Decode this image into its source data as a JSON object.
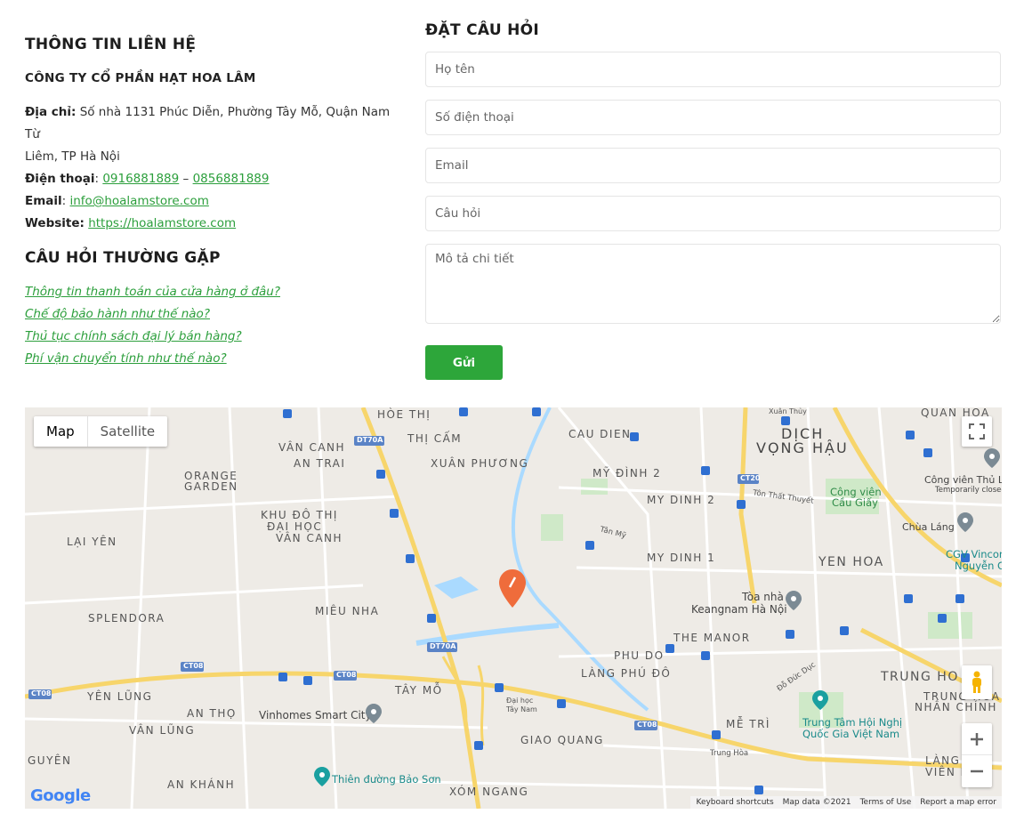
{
  "contact": {
    "title": "THÔNG TIN LIÊN HỆ",
    "company": "CÔNG TY CỔ PHẦN HẠT HOA LÂM",
    "address_label": "Địa chỉ:",
    "address_line1": "Số nhà 1131 Phúc Diễn, Phường Tây Mỗ, Quận Nam Từ",
    "address_line2": "Liêm, TP Hà Nội",
    "phone_label": "Điện thoại",
    "phone1": "0916881889",
    "phone_sep": " – ",
    "phone2": "0856881889",
    "email_label": "Email",
    "email": "info@hoalamstore.com",
    "website_label": "Website:",
    "website": "https://hoalamstore.com"
  },
  "faq": {
    "title": "CÂU HỎI THƯỜNG GẶP",
    "items": [
      "Thông tin thanh toán của cửa hàng ở đâu?",
      "Chế độ bảo hành như thế nào?",
      "Thủ tục chính sách đại lý bán hàng?",
      "Phí vận chuyển tính như thế nào?"
    ]
  },
  "form": {
    "title": "ĐẶT CÂU HỎI",
    "name_placeholder": "Họ tên",
    "phone_placeholder": "Số điện thoại",
    "email_placeholder": "Email",
    "question_placeholder": "Câu hỏi",
    "detail_placeholder": "Mô tả chi tiết",
    "submit_label": "Gửi",
    "submit_color": "#2da63a"
  },
  "map": {
    "type_map": "Map",
    "type_satellite": "Satellite",
    "labels": {
      "hoe_thi": "HÒE THỊ",
      "thi_cam": "THỊ CẤM",
      "van_canh": "VÂN CANH",
      "an_trai": "AN TRAI",
      "xuan_phuong": "XUÂN PHƯƠNG",
      "orange": "ORANGE",
      "garden": "GARDEN",
      "khu_do_thi": "KHU ĐÔ THỊ",
      "dai_hoc": "ĐẠI HỌC",
      "van_canh2": "VÂN CANH",
      "lai_yen": "LẠI YÊN",
      "splendora": "SPLENDORA",
      "mieu_nha": "MIÊU NHA",
      "yen_lung": "YÊN LŨNG",
      "an_tho": "AN THỌ",
      "van_lung": "VÂN LŨNG",
      "guyen": "GUYÊN",
      "an_khanh": "AN KHÁNH",
      "tay_mo": "TÂY MỖ",
      "giao_quang": "GIAO QUANG",
      "xom_ngang": "XÓM NGANG",
      "cau_dien": "CAU DIEN",
      "my_dinh_2": "MỸ ĐÌNH 2",
      "my_dinh_2b": "MY DINH 2",
      "my_dinh_1": "MY DINH 1",
      "dich": "DỊCH",
      "vong_hau": "VỌNG HẬU",
      "quan_hoa": "QUAN HOA",
      "xuan_thuy": "Xuân Thủy",
      "yen_hoa": "YEN HOA",
      "phu_do": "PHU DO",
      "lang_phu_do": "LÀNG PHÚ ĐÔ",
      "the_manor": "THE MANOR",
      "me_tri": "MỄ TRÌ",
      "trung_hoa": "TRUNG HO",
      "trung_hoa_nhan_chinh": "TRUNG HOA",
      "nhan_chinh": "NHÂN CHÍNH",
      "lang": "LÀNG",
      "vien_hu": "VIÊN HƯ",
      "toa_nha": "Tòa nhà",
      "keangnam": "Keangnam Hà Nội",
      "cong_vien": "Công viên",
      "cau_giay": "Cầu Giấy",
      "cong_vien_thu_le": "Công viên Thủ Lệ",
      "temp_closed": "Temporarily closed",
      "chua_lang": "Chùa Láng",
      "cgv": "CGV Vincom",
      "nguyen_c": "Nguyễn C",
      "trung_tam": "Trung Tâm Hội Nghị",
      "quoc_gia": "Quốc Gia Việt Nam",
      "vinhomes": "Vinhomes Smart City",
      "thien_duong": "Thiên đường Bảo Sơn",
      "ton_that_thuyet": "Tôn Thất Thuyết",
      "tan_my": "Tân Mỹ",
      "do_duc_duc": "Đỗ Đức Dục",
      "trung_hoa_road": "Trung Hòa",
      "dai_hoc_tay_nam": "Đại học",
      "tay_nam": "Tây Nam",
      "dt70a": "DT70A",
      "dt70a_2": "DT70A",
      "ct20": "CT20",
      "ct08_a": "CT08",
      "ct08_b": "CT08",
      "ct08_c": "CT08",
      "ct08_d": "CT08"
    },
    "footer": {
      "shortcuts": "Keyboard shortcuts",
      "data": "Map data ©2021",
      "terms": "Terms of Use",
      "report": "Report a map error"
    },
    "google": "Google",
    "pin_color": "#ef6c3b"
  }
}
